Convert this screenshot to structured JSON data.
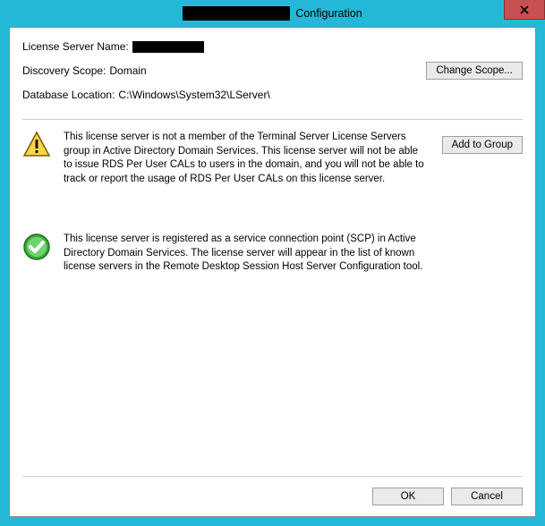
{
  "titlebar": {
    "title_suffix": "Configuration"
  },
  "info": {
    "license_server_label": "License Server Name:",
    "discovery_label": "Discovery Scope:",
    "discovery_value": "Domain",
    "change_scope_btn": "Change Scope...",
    "db_label": "Database Location:",
    "db_value": "C:\\Windows\\System32\\LServer\\"
  },
  "warning": {
    "text": "This license server is not a member of the Terminal Server License Servers group in Active Directory Domain Services. This license server will not be able to issue RDS Per User CALs to users in the domain, and you will not be able to track or report the usage of RDS Per User CALs on this license server.",
    "action": "Add to Group"
  },
  "ok_status": {
    "text": "This license server is registered as a service connection point (SCP) in Active Directory Domain Services. The license server will appear in the list of known license servers in the Remote Desktop Session Host Server Configuration tool."
  },
  "footer": {
    "ok": "OK",
    "cancel": "Cancel"
  }
}
